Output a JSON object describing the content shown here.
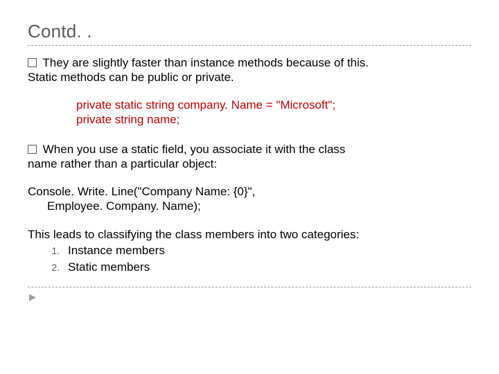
{
  "title": "Contd. .",
  "bullets": {
    "b1_line1": "They are slightly faster than instance methods because of this.",
    "b1_line2": "Static methods can be public or private.",
    "b2_line1": "When you use a static field, you associate it with the class",
    "b2_line2": "name rather than a particular object:"
  },
  "code": {
    "l1": "private static string company. Name = \"Microsoft\";",
    "l2": "private string name;"
  },
  "console": {
    "l1": "Console. Write. Line(\"Company Name: {0}\",",
    "l2": "Employee. Company. Name);"
  },
  "closing": "This leads to classifying the class members into two categories:",
  "categories": {
    "c1": "Instance members",
    "c2": "Static members"
  },
  "arrow_glyph": "▶"
}
